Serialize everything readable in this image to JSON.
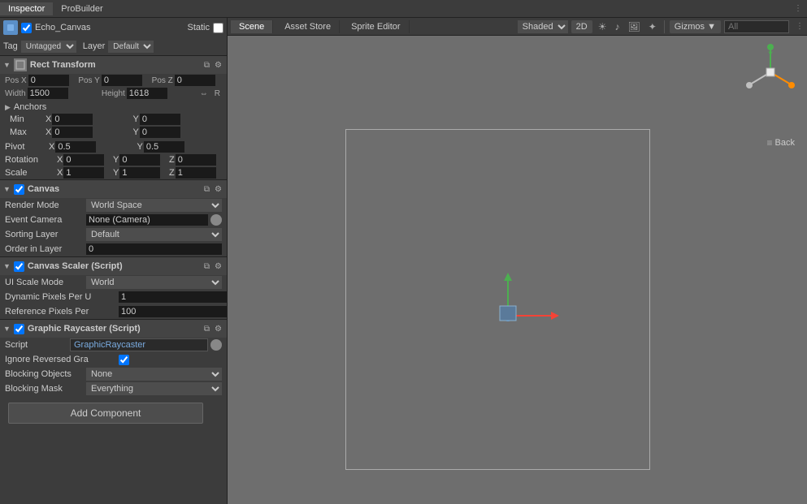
{
  "inspectorTab": {
    "label": "Inspector",
    "probuilder": "ProBuilder",
    "dots": "⋮"
  },
  "objectHeader": {
    "name": "Echo_Canvas",
    "staticLabel": "Static",
    "tagLabel": "Tag",
    "tagValue": "Untagged",
    "layerLabel": "Layer",
    "layerValue": "Default"
  },
  "rectTransform": {
    "title": "Rect Transform",
    "posXLabel": "Pos X",
    "posYLabel": "Pos Y",
    "posZLabel": "Pos Z",
    "posX": "0",
    "posY": "0",
    "posZ": "0",
    "widthLabel": "Width",
    "heightLabel": "Height",
    "width": "1500",
    "height": "1618",
    "anchors": {
      "title": "Anchors",
      "minLabel": "Min",
      "maxLabel": "Max",
      "minX": "0",
      "minY": "0",
      "maxX": "0",
      "maxY": "0"
    },
    "pivotLabel": "Pivot",
    "pivotX": "0.5",
    "pivotY": "0.5",
    "rotationLabel": "Rotation",
    "rotX": "0",
    "rotY": "0",
    "rotZ": "0",
    "scaleLabel": "Scale",
    "scaleX": "1",
    "scaleY": "1",
    "scaleZ": "1"
  },
  "canvas": {
    "title": "Canvas",
    "renderModeLabel": "Render Mode",
    "renderModeValue": "World Space",
    "eventCameraLabel": "Event Camera",
    "eventCameraValue": "None (Camera)",
    "sortingLayerLabel": "Sorting Layer",
    "sortingLayerValue": "Default",
    "orderInLayerLabel": "Order in Layer",
    "orderInLayerValue": "0"
  },
  "canvasScaler": {
    "title": "Canvas Scaler (Script)",
    "uiScaleModeLabel": "UI Scale Mode",
    "uiScaleModeValue": "World",
    "dynamicPixelsLabel": "Dynamic Pixels Per U",
    "dynamicPixelsValue": "1",
    "referencePixelsLabel": "Reference Pixels Per",
    "referencePixelsValue": "100"
  },
  "graphicRaycaster": {
    "title": "Graphic Raycaster (Script)",
    "scriptLabel": "Script",
    "scriptValue": "GraphicRaycaster",
    "ignoreLabel": "Ignore Reversed Gra",
    "blockingObjectsLabel": "Blocking Objects",
    "blockingObjectsValue": "None",
    "blockingMaskLabel": "Blocking Mask",
    "blockingMaskValue": "Everything"
  },
  "addComponent": {
    "label": "Add Component"
  },
  "sceneToolbar": {
    "scenTab": "Scene",
    "assetStoreTab": "Asset Store",
    "spriteEditorTab": "Sprite Editor",
    "shadedValue": "Shaded",
    "twoDLabel": "2D",
    "gizmosLabel": "Gizmos",
    "searchPlaceholder": "All"
  },
  "axisWidget": {
    "backLabel": "Back"
  }
}
